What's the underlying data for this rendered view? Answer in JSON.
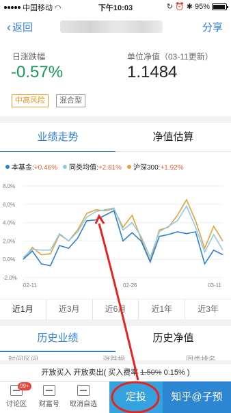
{
  "status": {
    "carrier": "中国移动",
    "time": "下午10:03",
    "battery": "95%"
  },
  "nav": {
    "back_label": "返回",
    "share_label": "分享"
  },
  "info": {
    "daily_change_label": "日涨跌幅",
    "daily_change_value": "-0.57%",
    "nav_label": "单位净值（03-11更新）",
    "nav_value": "1.1484",
    "tags": [
      "中高风险",
      "混合型"
    ]
  },
  "tabs": [
    "业绩走势",
    "净值估算"
  ],
  "legend": [
    {
      "name": "本基金:",
      "value": "+0.46%",
      "color": "#2c7fd3"
    },
    {
      "name": "同类均值:",
      "value": "+2.81%",
      "color": "#8ccbe8"
    },
    {
      "name": "沪深300:",
      "value": "+1.92%",
      "color": "#e5a136"
    }
  ],
  "chart_data": {
    "type": "line",
    "ylim": [
      -2,
      8
    ],
    "y_ticks": [
      "8.0%",
      "6.0%",
      "4.0%",
      "2.0%",
      "0.0%",
      "-2.0%"
    ],
    "x_ticks": [
      "02-11",
      "02-26",
      "03-11"
    ],
    "series": [
      {
        "name": "本基金",
        "color": "#2c7fd3",
        "values": [
          0.0,
          0.9,
          -0.5,
          -0.7,
          1.5,
          1.2,
          2.3,
          4.2,
          4.3,
          4.8,
          5.3,
          2.0,
          2.9,
          2.0,
          -0.3,
          2.5,
          2.7,
          3.0,
          2.8,
          3.0,
          -0.5,
          1.0,
          0.5
        ]
      },
      {
        "name": "同类均值",
        "color": "#8ccbe8",
        "values": [
          0.2,
          1.1,
          1.0,
          1.0,
          2.8,
          2.0,
          3.0,
          4.6,
          5.2,
          5.4,
          5.6,
          3.2,
          4.0,
          2.5,
          0.2,
          3.0,
          3.6,
          4.2,
          5.8,
          3.5,
          0.8,
          2.7,
          1.0
        ]
      },
      {
        "name": "沪深300",
        "color": "#e5a136",
        "values": [
          0.0,
          1.3,
          0.5,
          0.6,
          2.7,
          2.0,
          3.2,
          5.0,
          5.4,
          5.3,
          5.5,
          3.5,
          4.8,
          2.2,
          -0.2,
          3.2,
          3.5,
          4.8,
          6.5,
          4.2,
          1.2,
          3.6,
          2.0
        ]
      }
    ]
  },
  "ranges": [
    "近1月",
    "近3月",
    "近6月",
    "近1年",
    "近3年"
  ],
  "history_tabs": [
    "历史业绩",
    "历史净值"
  ],
  "history_header": [
    "时间区间",
    "涨跌幅",
    "同类排名"
  ],
  "notice": {
    "text_a": "开放买入 开放卖出( 买入费率 ",
    "old_rate": "1.50%",
    "new_rate": " 0.15%",
    "text_b": " )"
  },
  "bottom": {
    "discussion": "讨论区",
    "discussion_badge": "99+",
    "wealth": "财富号",
    "watchlist": "取消自选",
    "dingtou": "定投",
    "buy": "知乎@子预"
  }
}
